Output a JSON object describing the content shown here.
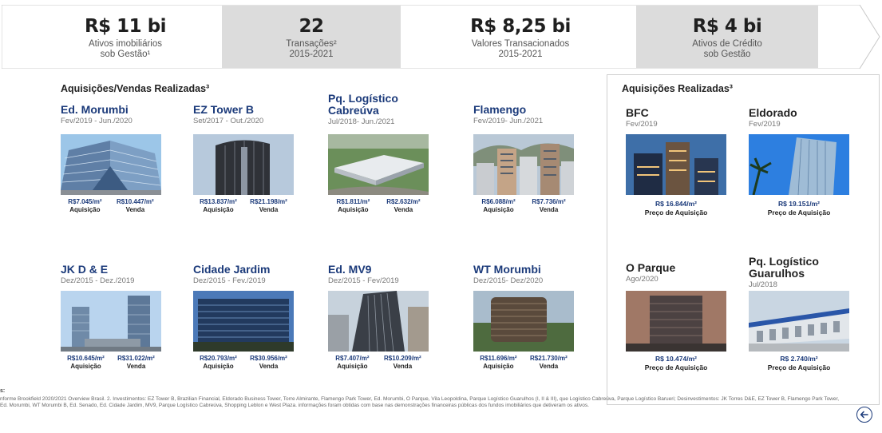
{
  "kpis": [
    {
      "value": "R$ 11 bi",
      "line1": "Ativos imobiliários",
      "line2": "sob Gestão¹"
    },
    {
      "value": "22",
      "line1": "Transações²",
      "line2": "2015-2021"
    },
    {
      "value": "R$ 8,25 bi",
      "line1": "Valores Transacionados",
      "line2": "2015-2021"
    },
    {
      "value": "R$ 4 bi",
      "line1": "Ativos de Crédito",
      "line2": "sob Gestão"
    }
  ],
  "left_title": "Aquisições/Vendas Realizadas³",
  "right_title": "Aquisições Realizadas³",
  "left_cards": [
    {
      "name": "Ed. Morumbi",
      "period": "Fev/2019 - Jun./2020",
      "buy": "R$7.045/m²",
      "sell": "R$10.447/m²",
      "buy_label": "Aquisição",
      "sell_label": "Venda"
    },
    {
      "name": "EZ Tower B",
      "period": "Set/2017 - Out./2020",
      "buy": "R$13.837/m²",
      "sell": "R$21.198/m²",
      "buy_label": "Aquisição",
      "sell_label": "Venda"
    },
    {
      "name": "Pq. Logístico Cabreúva",
      "period": "Jul/2018- Jun./2021",
      "buy": "R$1.811/m²",
      "sell": "R$2.632/m²",
      "buy_label": "Aquisição",
      "sell_label": "Venda"
    },
    {
      "name": "Flamengo",
      "period": "Fev/2019- Jun./2021",
      "buy": "R$6.088/m²",
      "sell": "R$7.736/m²",
      "buy_label": "Aquisição",
      "sell_label": "Venda"
    },
    {
      "name": "JK D & E",
      "period": "Dez/2015 - Dez./2019",
      "buy": "R$10.645/m²",
      "sell": "R$31.022/m²",
      "buy_label": "Aquisição",
      "sell_label": "Venda"
    },
    {
      "name": "Cidade Jardim",
      "period": "Dez/2015 - Fev./2019",
      "buy": "R$20.793/m²",
      "sell": "R$30.956/m²",
      "buy_label": "Aquisição",
      "sell_label": "Venda"
    },
    {
      "name": "Ed. MV9",
      "period": "Dez/2015 - Fev/2019",
      "buy": "R$7.407/m²",
      "sell": "R$10.209/m²",
      "buy_label": "Aquisição",
      "sell_label": "Venda"
    },
    {
      "name": "WT Morumbi",
      "period": "Dez/2015- Dez/2020",
      "buy": "R$11.696/m²",
      "sell": "R$21.730/m²",
      "buy_label": "Aquisição",
      "sell_label": "Venda"
    }
  ],
  "right_cards": [
    {
      "name": "BFC",
      "period": "Fev/2019",
      "price": "R$ 16.844/m²",
      "label": "Preço de Aquisição"
    },
    {
      "name": "Eldorado",
      "period": "Fev/2019",
      "price": "R$ 19.151/m²",
      "label": "Preço de Aquisição"
    },
    {
      "name": "O Parque",
      "period": "Ago/2020",
      "price": "R$ 10.474/m²",
      "label": "Preço de Aquisição"
    },
    {
      "name": "Pq. Logístico Guarulhos",
      "period": "Jul/2018",
      "price": "R$ 2.740/m²",
      "label": "Preço de Aquisição"
    }
  ],
  "footnote_label": "s:",
  "footnote": "nforme Brookfield 2020/2021 Overview Brasil. 2. Investimentos: EZ Tower B, Brazilian Financial, Eldorado Business Tower, Torre Almirante, Flamengo Park Tower, Ed. Morumbi, O Parque, Vila Leopoldina, Parque Logístico Guarulhos (I, II & III), que Logístico Cabreúva, Parque Logístico Barueri; Desinvestimentos: JK Torres D&E, EZ Tower B, Flamengo Park Tower, Ed. Morumbi, WT Morumbi B, Ed. Senado, Ed. Cidade Jardim, MV9, Parque Logístico Cabreúva, Shopping Leblon e West Plaza. informações foram obtidas com base nas demonstrações financeiras públicas dos fundos imobiliários que detiveram os ativos.",
  "colors": {
    "navy": "#1b3a7a",
    "grey_band": "#dcdcdc"
  }
}
